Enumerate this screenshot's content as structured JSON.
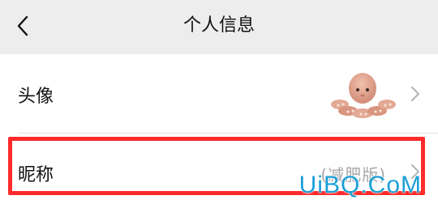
{
  "navbar": {
    "title": "个人信息",
    "back_icon": "chevron-left-icon"
  },
  "rows": {
    "avatar": {
      "label": "头像",
      "value_icon": "octopus-avatar-image",
      "chevron_icon": "chevron-right-icon"
    },
    "nickname": {
      "label": "昵称",
      "value": "(减肥版)",
      "chevron_icon": "chevron-right-icon"
    }
  },
  "watermark": {
    "text": "UiBQ.CoM"
  },
  "colors": {
    "background": "#ededed",
    "row_background": "#ffffff",
    "highlight": "#ff2a2a",
    "watermark": "#1a9fd6",
    "secondary_text": "#a6a6a6"
  }
}
